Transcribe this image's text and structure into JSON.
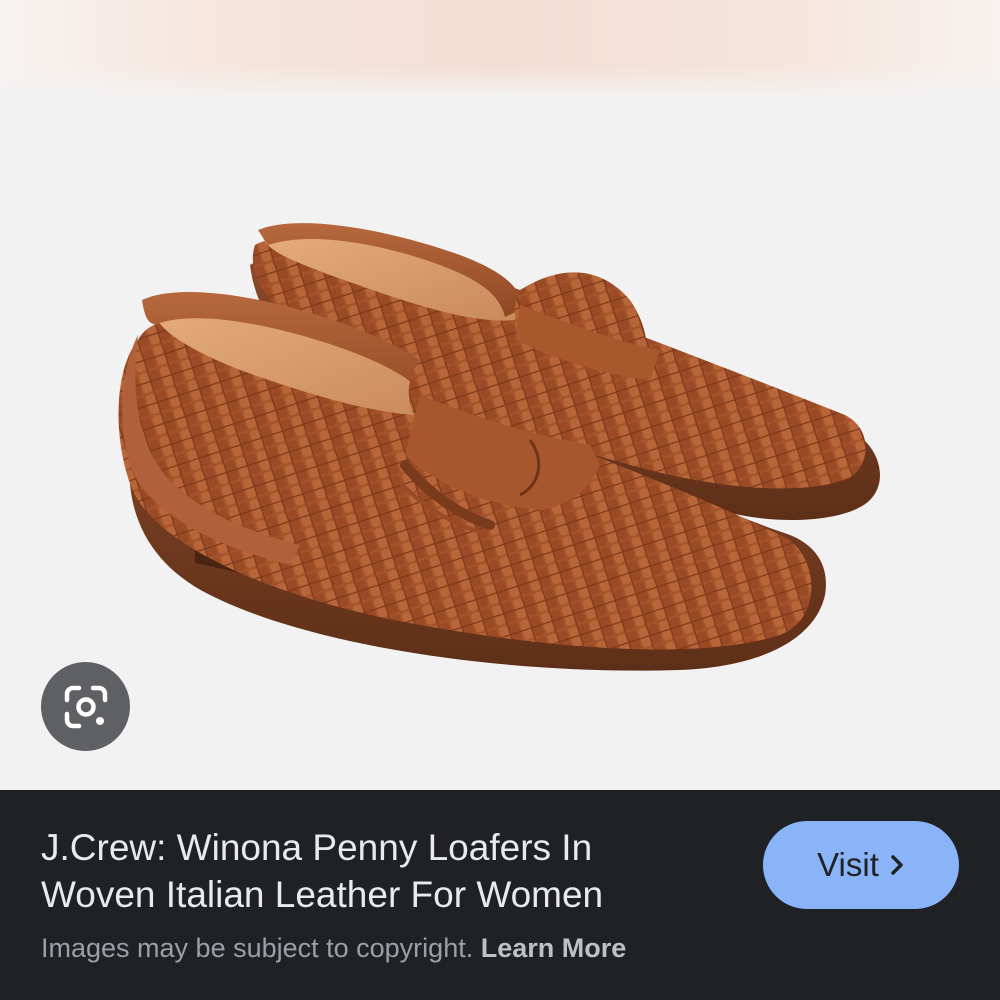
{
  "product": {
    "title_line1": "J.Crew: Winona Penny Loafers In",
    "title_line2": "Woven Italian Leather For Women"
  },
  "footer": {
    "copyright_text": "Images may be subject to copyright. ",
    "learn_more_label": "Learn More"
  },
  "actions": {
    "visit_label": "Visit"
  },
  "icons": {
    "lens": "google-lens-icon",
    "visit_chevron": "chevron-right-icon"
  },
  "colors": {
    "panel_background": "#202124",
    "visit_button": "#8ab4f8",
    "title_text": "#e8eaed",
    "secondary_text": "#9aa0a6",
    "lens_button": "#5f6063"
  }
}
